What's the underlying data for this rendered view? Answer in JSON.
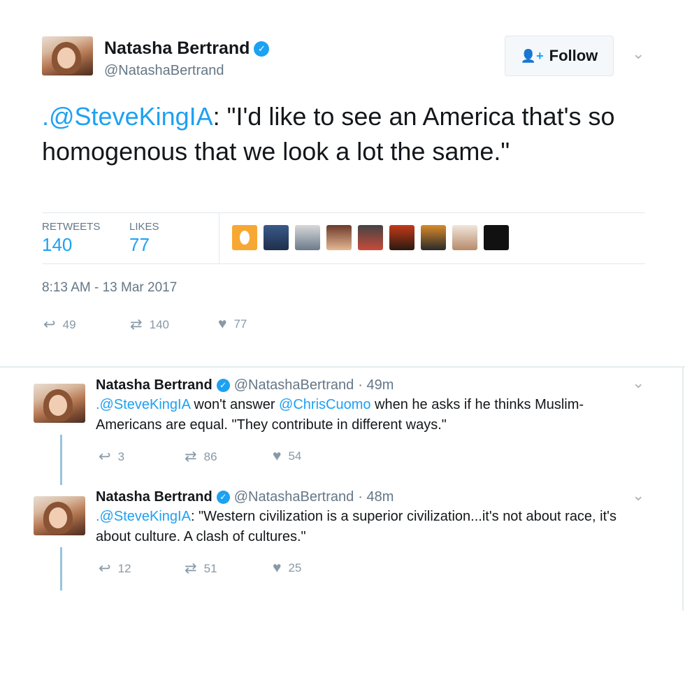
{
  "main_tweet": {
    "author_name": "Natasha Bertrand",
    "author_handle": "@NatashaBertrand",
    "follow_label": "Follow",
    "text_mention": ".@SteveKingIA",
    "text_body": ": \"I'd like to see an America that's so homogenous that we look a lot the same.\"",
    "retweets_label": "RETWEETS",
    "retweets_count": "140",
    "likes_label": "LIKES",
    "likes_count": "77",
    "timestamp": "8:13 AM - 13 Mar 2017",
    "actions": {
      "replies": "49",
      "retweets": "140",
      "likes": "77"
    }
  },
  "replies": [
    {
      "author_name": "Natasha Bertrand",
      "author_handle": "@NatashaBertrand",
      "time": "· 49m",
      "mention1": ".@SteveKingIA",
      "text1": " won't answer ",
      "mention2": "@ChrisCuomo",
      "text2": " when he asks if he thinks Muslim-Americans are equal. \"They contribute in different ways.\"",
      "actions": {
        "replies": "3",
        "retweets": "86",
        "likes": "54"
      }
    },
    {
      "author_name": "Natasha Bertrand",
      "author_handle": "@NatashaBertrand",
      "time": "· 48m",
      "mention1": ".@SteveKingIA",
      "text1": ": \"Western civilization is a superior civilization...it's not about race, it's about culture. A clash of cultures.\"",
      "actions": {
        "replies": "12",
        "retweets": "51",
        "likes": "25"
      }
    }
  ],
  "icons": {
    "verified": "checkmark-badge-icon",
    "reply": "reply-arrow-icon",
    "retweet": "retweet-icon",
    "like": "heart-icon",
    "chevron": "chevron-down-icon",
    "follow": "add-user-icon"
  },
  "colors": {
    "link": "#1da1f2",
    "muted": "#657786",
    "thread_line": "#9ac3dc"
  }
}
